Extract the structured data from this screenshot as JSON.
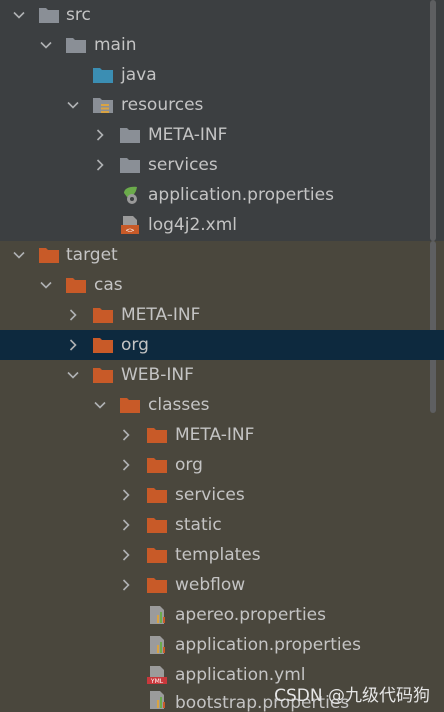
{
  "tree": {
    "src": "src",
    "main": "main",
    "java": "java",
    "resources": "resources",
    "res_meta_inf": "META-INF",
    "res_services": "services",
    "res_application_properties": "application.properties",
    "res_log4j2": "log4j2.xml",
    "target": "target",
    "cas": "cas",
    "cas_meta_inf": "META-INF",
    "cas_org": "org",
    "web_inf": "WEB-INF",
    "classes": "classes",
    "cls_meta_inf": "META-INF",
    "cls_org": "org",
    "cls_services": "services",
    "cls_static": "static",
    "cls_templates": "templates",
    "cls_webflow": "webflow",
    "apereo_properties": "apereo.properties",
    "cls_application_properties": "application.properties",
    "application_yml": "application.yml",
    "bootstrap_properties": "bootstrap.properties"
  },
  "icons": {
    "folder_gray": "folder-icon",
    "folder_blue": "source-folder-icon",
    "folder_orange": "excluded-folder-icon",
    "resources": "resources-folder-icon",
    "spring_properties": "spring-properties-icon",
    "xml": "xml-file-icon",
    "properties": "properties-file-icon",
    "yml": "yml-file-icon"
  },
  "colors": {
    "src_background": "#3c3f41",
    "target_background": "#4a473d",
    "selection": "#0d293e",
    "folder_gray": "#8a8f96",
    "folder_blue": "#3b8eb3",
    "folder_orange": "#c85a28"
  },
  "watermark": "CSDN @九级代码狗"
}
